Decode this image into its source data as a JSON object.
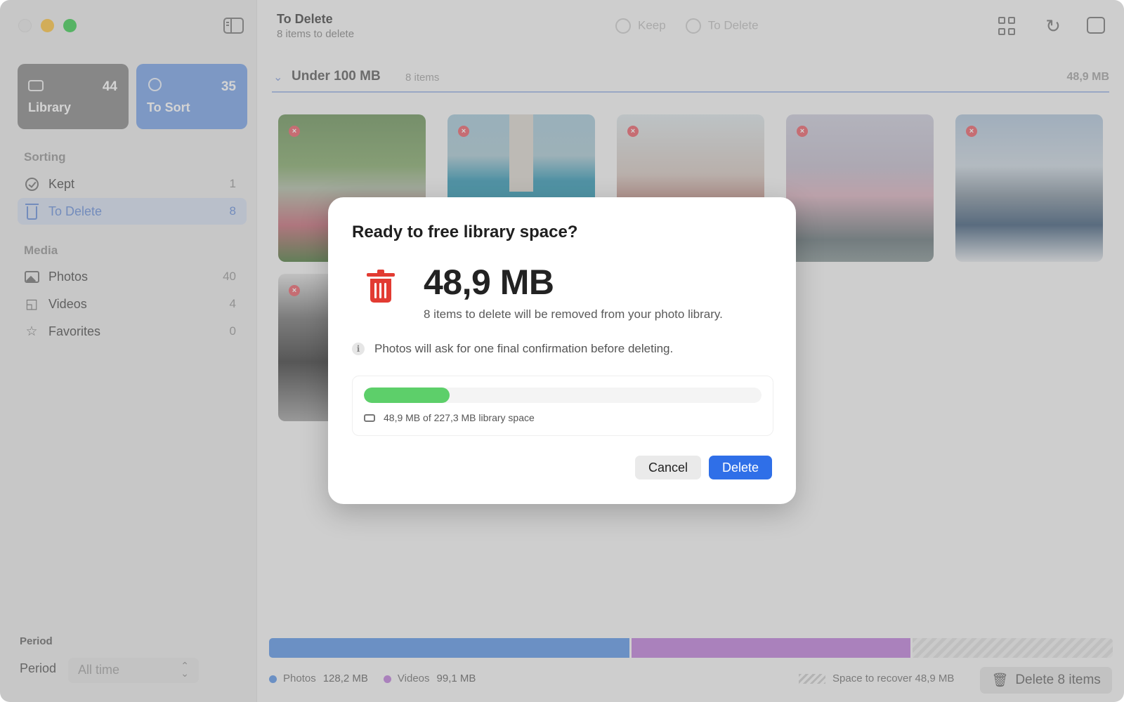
{
  "window": {
    "title": "To Delete",
    "subtitle": "8 items to delete"
  },
  "sidebar": {
    "cards": [
      {
        "label": "Library",
        "count": "44",
        "icon": "tray-icon"
      },
      {
        "label": "To Sort",
        "count": "35",
        "icon": "list-circle-icon"
      }
    ],
    "sorting_title": "Sorting",
    "sorting": [
      {
        "label": "Kept",
        "count": "1",
        "icon": "checkmark-circle-icon"
      },
      {
        "label": "To Delete",
        "count": "8",
        "icon": "trash-icon",
        "selected": true
      }
    ],
    "media_title": "Media",
    "media": [
      {
        "label": "Photos",
        "count": "40",
        "icon": "photo-icon"
      },
      {
        "label": "Videos",
        "count": "4",
        "icon": "video-icon"
      },
      {
        "label": "Favorites",
        "count": "0",
        "icon": "star-icon"
      }
    ],
    "period_title": "Period",
    "period_label": "Period",
    "period_value": "All time"
  },
  "toolbar": {
    "keep_label": "Keep",
    "to_delete_label": "To Delete"
  },
  "group": {
    "title": "Under 100 MB",
    "count": "8 items",
    "size": "48,9 MB"
  },
  "footer": {
    "photos_label": "Photos",
    "photos_size": "128,2 MB",
    "videos_label": "Videos",
    "videos_size": "99,1 MB",
    "recover_label": "Space to recover 48,9 MB",
    "delete_button": "Delete 8 items",
    "colors": {
      "photos": "#4d8ce6",
      "videos": "#b873d8"
    },
    "bar_fractions": {
      "photos": 0.4275,
      "videos": 0.3305
    }
  },
  "modal": {
    "title": "Ready to free library space?",
    "size": "48,9 MB",
    "description": "8 items to delete will be removed from your photo library.",
    "info": "Photos will ask for one final confirmation before deleting.",
    "usage_caption": "48,9 MB of 227,3 MB library space",
    "usage_fraction": 0.215,
    "cancel_label": "Cancel",
    "delete_label": "Delete",
    "colors": {
      "fill": "#5dcf6a",
      "primary": "#2f6fe8",
      "trash": "#e23b32"
    }
  }
}
